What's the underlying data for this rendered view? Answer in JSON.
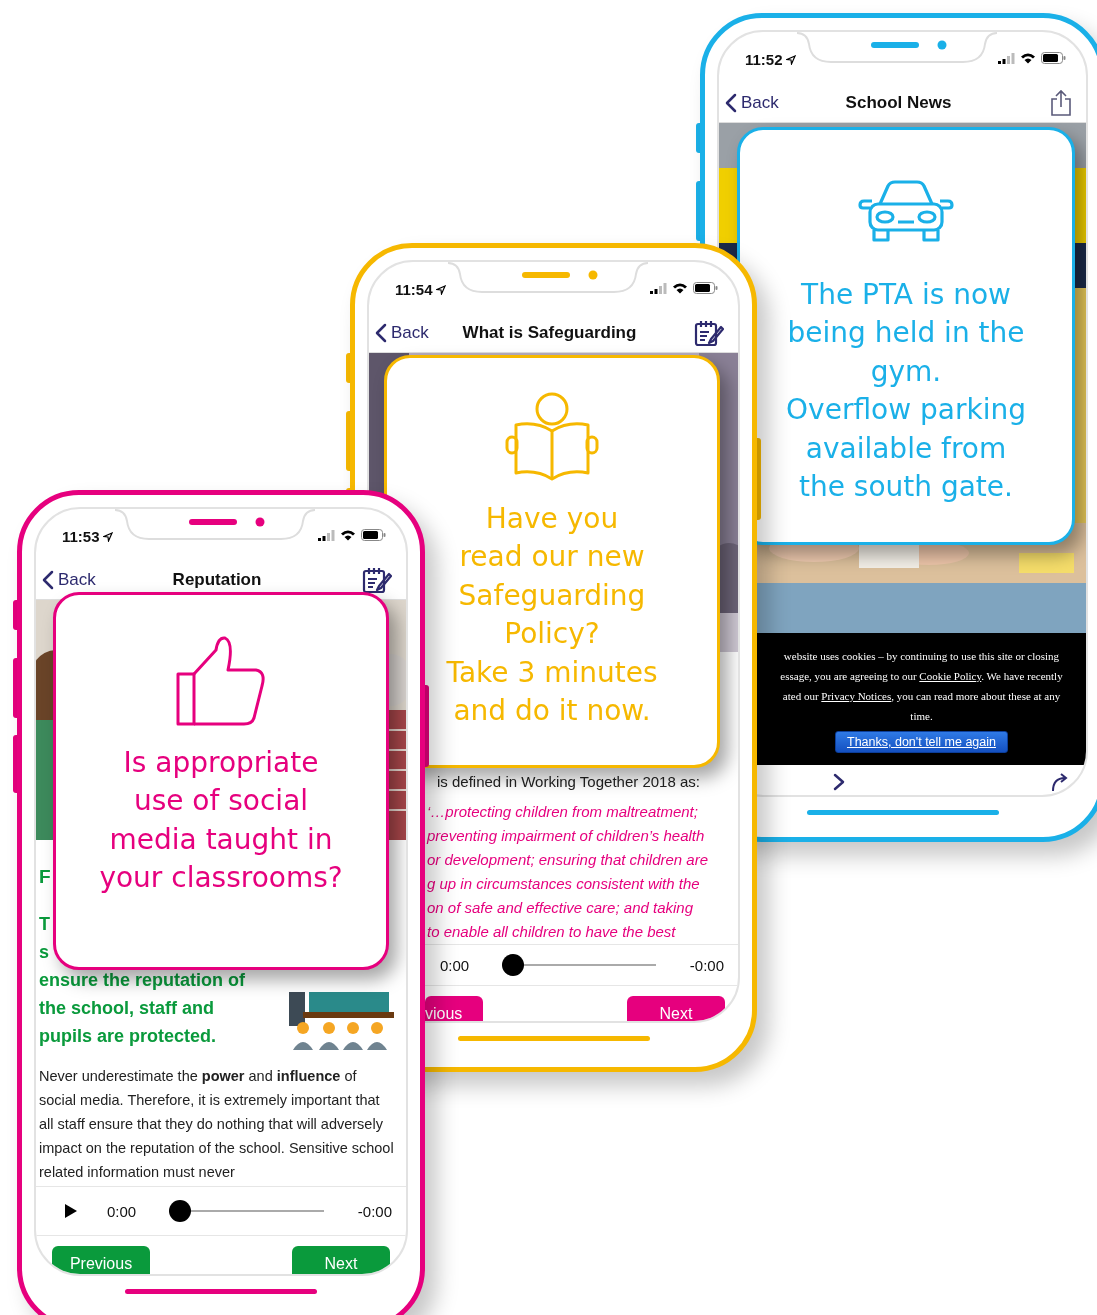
{
  "phones": [
    {
      "kind": "news",
      "color": "#1ab0e8",
      "status_time": "11:52",
      "back_label": "Back",
      "title": "School News",
      "popup": {
        "lines": [
          "The PTA is now",
          "being held in the",
          "gym.",
          "Overflow parking",
          "available from",
          "the south gate."
        ]
      },
      "cookie_banner": {
        "lines": [
          [
            {
              "text": "website uses cookies – by continuing to use this site or closing"
            }
          ],
          [
            {
              "text": "essage, you are agreeing to our "
            },
            {
              "text": "Cookie Policy",
              "link": true
            },
            {
              "text": ". We have recently"
            }
          ],
          [
            {
              "text": "ated our "
            },
            {
              "text": "Privacy Notices",
              "link": true
            },
            {
              "text": ", you can read more about these at any"
            }
          ],
          [
            {
              "text": "time."
            }
          ]
        ],
        "button": "Thanks, don't tell me again"
      }
    },
    {
      "kind": "lesson",
      "color": "#f6b800",
      "status_time": "11:54",
      "back_label": "Back",
      "title": "What is Safeguarding",
      "popup": {
        "lines": [
          "Have you",
          "read our new",
          "Safeguarding",
          "Policy?",
          "Take 3 minutes",
          "and do it now."
        ]
      },
      "intro": "is defined in Working Together 2018 as:",
      "quote_lines": [
        "‘…protecting children from maltreatment;",
        "preventing impairment of children’s health",
        "or development; ensuring that children are",
        "g up in circumstances consistent with the",
        "on of safe and effective care; and taking",
        "to enable all children to have the best"
      ],
      "player": {
        "elapsed": "0:00",
        "remaining": "-0:00",
        "level": 0
      },
      "buttons": {
        "color": "#e6007e",
        "previous": "vious",
        "next": "Next"
      }
    },
    {
      "kind": "lesson",
      "color": "#e6007e",
      "status_time": "11:53",
      "back_label": "Back",
      "title": "Reputation",
      "popup": {
        "lines": [
          "Is appropriate",
          "use of social",
          "media taught in",
          "your classrooms?"
        ]
      },
      "heading_fragment": "F",
      "lead_fragments": [
        "T",
        "s"
      ],
      "lead_lines": [
        "ensure the reputation of",
        "the school, staff and",
        "pupils are protected."
      ],
      "paragraph": "Never underestimate the **power** and **influence** of social media. Therefore, it is extremely important that all staff ensure that they do nothing that will adversely impact on the reputation of the school. Sensitive school related information must never",
      "player": {
        "elapsed": "0:00",
        "remaining": "-0:00",
        "level": 0
      },
      "buttons": {
        "color": "#0a9a3c",
        "previous": "Previous",
        "next": "Next"
      }
    }
  ]
}
